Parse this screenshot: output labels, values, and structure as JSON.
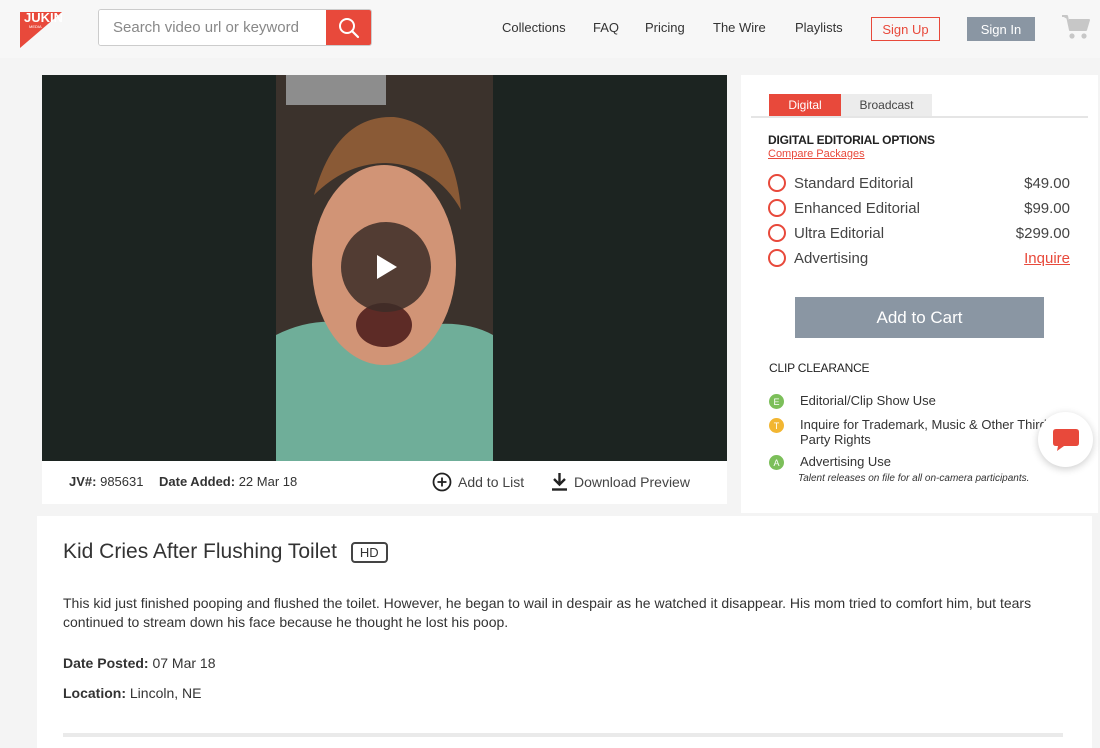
{
  "brand": {
    "logo_text": "JUKIN",
    "logo_sub": "MEDIA",
    "accent": "#e8493b"
  },
  "search": {
    "placeholder": "Search video url or keyword",
    "value": ""
  },
  "nav": {
    "items": [
      "Collections",
      "FAQ",
      "Pricing",
      "The Wire",
      "Playlists"
    ],
    "signup": "Sign Up",
    "signin": "Sign In"
  },
  "video": {
    "jv_label": "JV#:",
    "jv_value": "985631",
    "date_label": "Date Added:",
    "date_value": "22 Mar 18",
    "add_to_list": "Add to List",
    "download_preview": "Download Preview"
  },
  "panel": {
    "tabs": [
      "Digital",
      "Broadcast"
    ],
    "options_title": "DIGITAL EDITORIAL OPTIONS",
    "compare_link": "Compare Packages",
    "options": [
      {
        "name": "Standard Editorial",
        "price": "$49.00"
      },
      {
        "name": "Enhanced Editorial",
        "price": "$99.00"
      },
      {
        "name": "Ultra Editorial",
        "price": "$299.00"
      },
      {
        "name": "Advertising",
        "price": "Inquire"
      }
    ],
    "add_to_cart": "Add to Cart",
    "clearance_title": "CLIP CLEARANCE",
    "clearance": [
      {
        "badge": "E",
        "text": "Editorial/Clip Show Use",
        "color": "#7cbf5a"
      },
      {
        "badge": "T",
        "text": "Inquire for Trademark, Music & Other Third Party Rights",
        "color": "#f2b632"
      },
      {
        "badge": "A",
        "text": "Advertising Use",
        "color": "#7cbf5a"
      }
    ],
    "clearance_note": "Talent releases on file for all on-camera participants."
  },
  "clip": {
    "title": "Kid Cries After Flushing Toilet",
    "badge": "HD",
    "description": "This kid just finished pooping and flushed the toilet. However, he began to wail in despair as he watched it disappear. His mom tried to comfort him, but tears continued to stream down his face because he thought he lost his poop.",
    "posted_label": "Date Posted:",
    "posted_value": "07 Mar 18",
    "location_label": "Location:",
    "location_value": "Lincoln, NE"
  }
}
